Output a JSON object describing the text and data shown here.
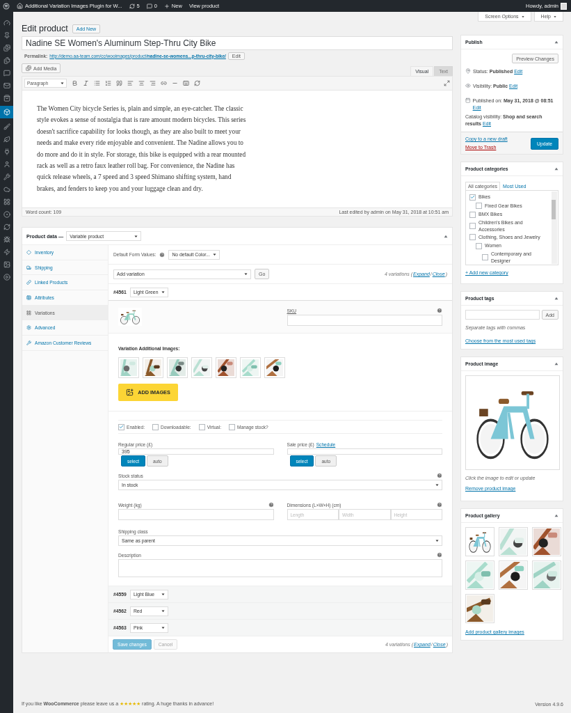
{
  "admin_bar": {
    "site": "Additional Variation Images Plugin for W...",
    "updates": "5",
    "comments": "0",
    "new": "New",
    "view": "View product",
    "greeting": "Howdy, admin"
  },
  "admin_menu": [
    {
      "selected": false
    },
    {
      "selected": false
    },
    {
      "selected": false
    },
    {
      "selected": false
    },
    {
      "selected": false
    },
    {
      "selected": false
    },
    {
      "selected": false
    },
    {
      "selected": true
    },
    {
      "selected": false
    },
    {
      "selected": false
    },
    {
      "selected": false
    },
    {
      "selected": false
    },
    {
      "selected": false
    },
    {
      "selected": false
    },
    {
      "selected": false
    },
    {
      "selected": false
    },
    {
      "selected": false
    },
    {
      "selected": false
    },
    {
      "selected": false
    },
    {
      "selected": false
    },
    {
      "selected": false
    }
  ],
  "screen_buttons": [
    "Screen Options",
    "Help"
  ],
  "page_title": "Edit product",
  "add_new": "Add New",
  "post_title": "Nadine SE Women's Aluminum Step-Thru City Bike",
  "permalink": {
    "label": "Permalink:",
    "url": "http://demo.aa-team.com/cc/wooimages/product/**nadine-se-womens...p-thru-city-bike/**",
    "edit": "Edit"
  },
  "editor": {
    "add_media": "Add Media",
    "tabs": [
      {
        "label": "Visual",
        "selected": true
      },
      {
        "label": "Text",
        "selected": false
      }
    ],
    "format": "Paragraph",
    "content": "The Women City bicycle Series is, plain and simple, an eye-catcher. The classic style evokes a sense of nostalgia that is rare amount modern bicycles. This series doesn't sacrifice capability for looks though, as they are also built to meet your needs and make every ride enjoyable and convenient. The Nadine allows you to do more and do it in style. For storage, this bike is equipped with a rear mounted rack as well as a retro faux leather roll bag. For convenience, the Nadine has quick release wheels, a 7 speed and 3 speed Shimano shifting system, hand brakes, and fenders to keep you and your luggage clean and dry.",
    "word_count": "Word count: 109",
    "last_edited": "Last edited by admin on May 31, 2018 at 10:51 am"
  },
  "product_data": {
    "label": "Product data —",
    "type": "Variable product",
    "tabs": [
      {
        "label": "Inventory",
        "selected": false
      },
      {
        "label": "Shipping",
        "selected": false
      },
      {
        "label": "Linked Products",
        "selected": false
      },
      {
        "label": "Attributes",
        "selected": false
      },
      {
        "label": "Variations",
        "selected": true
      },
      {
        "label": "Advanced",
        "selected": false
      },
      {
        "label": "Amazon Customer Reviews",
        "selected": false
      }
    ],
    "default_form": {
      "label": "Default Form Values:",
      "value": "No default Color..."
    },
    "add_variation": {
      "value": "Add variation",
      "button": "Go"
    },
    "summaries": [
      {
        "prefix": "4 variations (",
        "expand": "Expand",
        "separator": "/",
        "close": "Close",
        "suffix": ")"
      },
      {
        "prefix": "4 variations (",
        "expand": "Expand",
        "separator": "/",
        "close": "Close",
        "suffix": ")"
      }
    ],
    "variations": [
      {
        "id": "#4561",
        "value": "Light Green",
        "expanded": true,
        "detail": {
          "sku_label": "SKU",
          "images_title": "Variation Additional Images:",
          "add_images": "ADD IMAGES",
          "options": [
            {
              "label": "Enabled:",
              "checked": true
            },
            {
              "label": "Downloadable:",
              "checked": false
            },
            {
              "label": "Virtual:",
              "checked": false
            },
            {
              "label": "Manage stock?",
              "checked": false
            }
          ],
          "regular_price": {
            "label": "Regular price (£)",
            "value": "395",
            "modes": [
              {
                "label": "select",
                "selected": true
              },
              {
                "label": "auto",
                "selected": false
              }
            ]
          },
          "sale_price": {
            "label": "Sale price (£)",
            "link": "Schedule",
            "modes": [
              {
                "label": "select",
                "selected": true
              },
              {
                "label": "auto",
                "selected": false
              }
            ]
          },
          "stock_status": {
            "label": "Stock status",
            "value": "In stock"
          },
          "weight": {
            "label": "Weight (kg)"
          },
          "dimensions": {
            "label": "Dimensions (L×W×H) (cm)",
            "placeholders": [
              "Length",
              "Width",
              "Height"
            ]
          },
          "shipping_class": {
            "label": "Shipping class",
            "value": "Same as parent"
          },
          "description": {
            "label": "Description"
          }
        }
      },
      {
        "id": "#4559",
        "value": "Light Blue",
        "expanded": false
      },
      {
        "id": "#4562",
        "value": "Red",
        "expanded": false
      },
      {
        "id": "#4563",
        "value": "Pink",
        "expanded": false
      }
    ],
    "buttons": [
      {
        "label": "Save changes",
        "kind": "primary",
        "disabled": true
      },
      {
        "label": "Cancel",
        "kind": "secondary",
        "disabled": true
      }
    ]
  },
  "publish": {
    "title": "Publish",
    "preview": "Preview Changes",
    "rows": [
      {
        "kind": "status",
        "text": "Status: **Published**",
        "edit": "Edit"
      },
      {
        "kind": "visibility",
        "text": "Visibility: **Public**",
        "edit": "Edit"
      },
      {
        "kind": "date",
        "text": "Published on: **May 31, 2018 @ 08:51**",
        "edit": "Edit"
      },
      {
        "kind": "catalog",
        "text": "Catalog visibility: **Shop and search results**",
        "edit": "Edit"
      }
    ],
    "copy": "Copy to a new draft",
    "trash": "Move to Trash",
    "update": "Update"
  },
  "categories": {
    "title": "Product categories",
    "tabs": [
      {
        "label": "All categories",
        "selected": true
      },
      {
        "label": "Most Used",
        "selected": false
      }
    ],
    "items": [
      {
        "label": "Bikes",
        "checked": true,
        "children": [
          {
            "label": "Fixed Gear Bikes",
            "checked": false
          }
        ]
      },
      {
        "label": "BMX Bikes",
        "checked": false
      },
      {
        "label": "Children's Bikes and Accessories",
        "checked": false
      },
      {
        "label": "Clothing, Shoes and Jewelry",
        "checked": false,
        "children": [
          {
            "label": "Women",
            "checked": false,
            "children": [
              {
                "label": "Contemporary and Designer",
                "checked": false
              }
            ]
          }
        ]
      }
    ],
    "add": "+ Add new category"
  },
  "tags": {
    "title": "Product tags",
    "button": "Add",
    "hint": "Separate tags with commas",
    "link": "Choose from the most used tags"
  },
  "product_image": {
    "title": "Product image",
    "hint": "Click the image to edit or update",
    "link": "Remove product image"
  },
  "gallery": {
    "title": "Product gallery",
    "link": "Add product gallery images"
  },
  "footer": {
    "before": "If you like **WooCommerce** please leave us a",
    "rating_link": "★★★★★",
    "after": "rating. A huge thanks in advance!",
    "version": "Version 4.9.6"
  }
}
